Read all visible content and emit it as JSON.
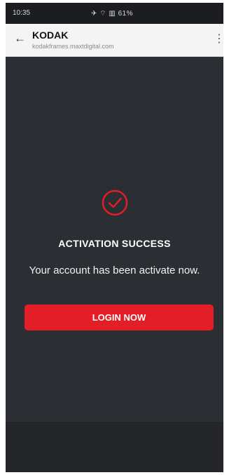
{
  "status_bar": {
    "time": "10:35",
    "right_indicators": "61%"
  },
  "browser": {
    "title": "KODAK",
    "url": "kodakframes.maxtdigital.com",
    "back_icon": "arrow-left-icon",
    "menu_icon": "kebab-menu-icon"
  },
  "activation": {
    "icon": "check-circle-icon",
    "title": "ACTIVATION SUCCESS",
    "message": "Your account has been activate now.",
    "login_label": "LOGIN NOW"
  },
  "colors": {
    "accent": "#e41e26",
    "background": "#2b2e33"
  }
}
